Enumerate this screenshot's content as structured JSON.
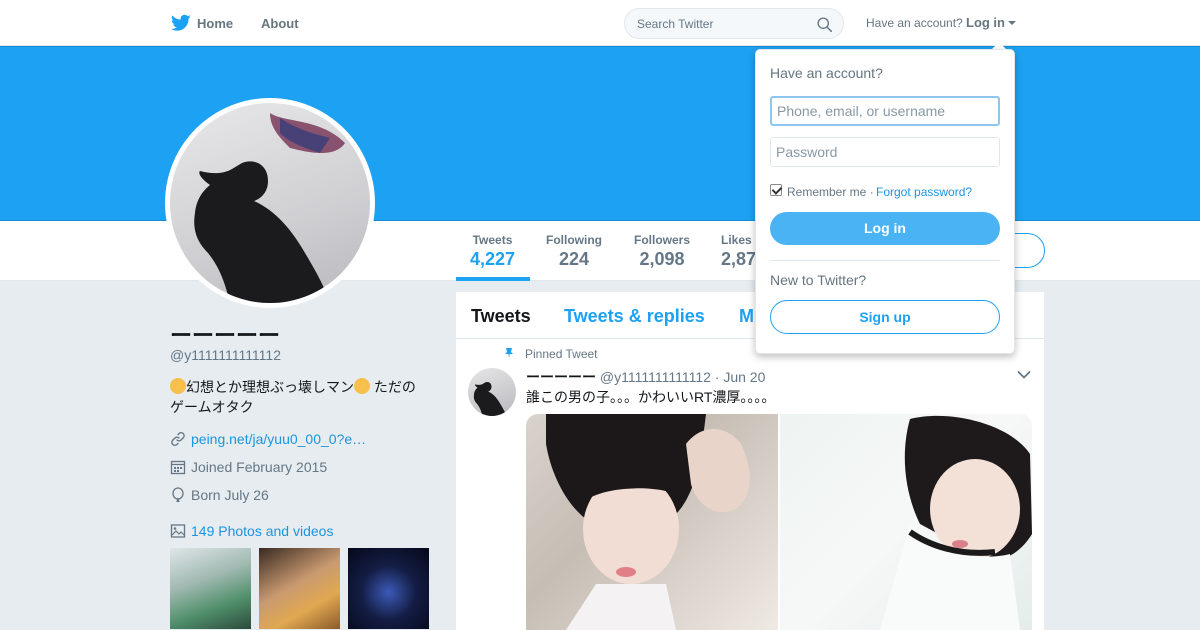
{
  "nav": {
    "home_label": "Home",
    "about_label": "About",
    "search_placeholder": "Search Twitter",
    "have_account": "Have an account?",
    "login_label": "Log in"
  },
  "profile": {
    "name": "ーーーーー",
    "handle": "@y1111111111112",
    "bio": "幻想とか理想ぶっ壊しマン ただのゲームオタク",
    "bio_part1": "幻想とか理想ぶっ壊しマン",
    "bio_part2": " ただの",
    "bio_part3": "ゲームオタク",
    "link": "peing.net/ja/yuu0_00_0?e…",
    "joined": "Joined February 2015",
    "born": "Born July 26",
    "photos_label": "149 Photos and videos"
  },
  "stats": [
    {
      "label": "Tweets",
      "value": "4,227"
    },
    {
      "label": "Following",
      "value": "224"
    },
    {
      "label": "Followers",
      "value": "2,098"
    },
    {
      "label": "Likes",
      "value": "2,87"
    }
  ],
  "timeline": {
    "tabs": [
      "Tweets",
      "Tweets & replies",
      "M"
    ],
    "pinned_label": "Pinned Tweet",
    "tweet": {
      "name": "ーーーーー",
      "handle_date": "@y1111111111112 · Jun 20",
      "text": "誰この男の子。。。かわいいRT濃厚。。。。"
    }
  },
  "login_dropdown": {
    "title": "Have an account?",
    "username_placeholder": "Phone, email, or username",
    "password_placeholder": "Password",
    "remember_label": "Remember me ·",
    "forgot_label": "Forgot password?",
    "login_button": "Log in",
    "new_label": "New to Twitter?",
    "signup_button": "Sign up"
  },
  "colors": {
    "brand": "#1da1f2",
    "link": "#1b95e0",
    "background": "#e6ecf0"
  }
}
